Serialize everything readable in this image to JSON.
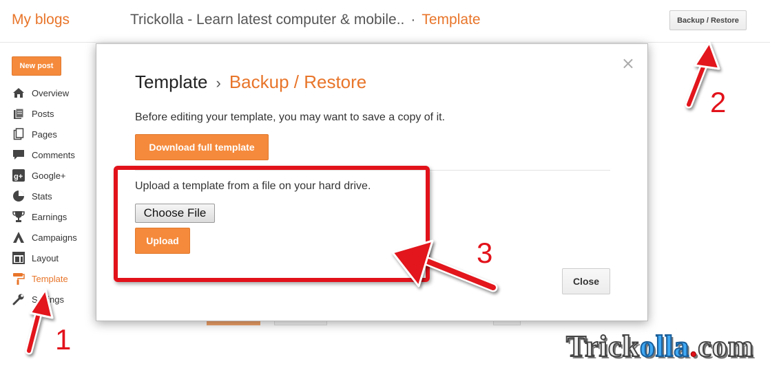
{
  "header": {
    "brand": "My blogs",
    "blog_title": "Trickolla - Learn latest computer & mobile..",
    "separator": "·",
    "crumb": "Template",
    "backup_button": "Backup / Restore"
  },
  "sidebar": {
    "new_post": "New post",
    "items": [
      {
        "label": "Overview",
        "icon": "home-icon"
      },
      {
        "label": "Posts",
        "icon": "posts-icon"
      },
      {
        "label": "Pages",
        "icon": "pages-icon"
      },
      {
        "label": "Comments",
        "icon": "comment-icon"
      },
      {
        "label": "Google+",
        "icon": "google-plus-icon"
      },
      {
        "label": "Stats",
        "icon": "stats-icon"
      },
      {
        "label": "Earnings",
        "icon": "trophy-icon"
      },
      {
        "label": "Campaigns",
        "icon": "campaigns-icon"
      },
      {
        "label": "Layout",
        "icon": "layout-icon"
      },
      {
        "label": "Template",
        "icon": "paint-roller-icon",
        "active": true
      },
      {
        "label": "Settings",
        "icon": "wrench-icon"
      }
    ]
  },
  "modal": {
    "title": "Template",
    "chevron": "›",
    "subtitle": "Backup / Restore",
    "close_symbol": "×",
    "description": "Before editing your template, you may want to save a copy of it.",
    "download_button": "Download full template",
    "upload_description": "Upload a template from a file on your hard drive.",
    "choose_file_button": "Choose File",
    "upload_button": "Upload",
    "close_button": "Close"
  },
  "annotations": {
    "step1": "1",
    "step2": "2",
    "step3": "3"
  },
  "watermark": {
    "part1": "Trick",
    "part2": "olla",
    "part3": ".",
    "part4": "com"
  },
  "colors": {
    "accent": "#e8752a",
    "button_orange": "#f58a3c",
    "annotation_red": "#e2121b"
  }
}
